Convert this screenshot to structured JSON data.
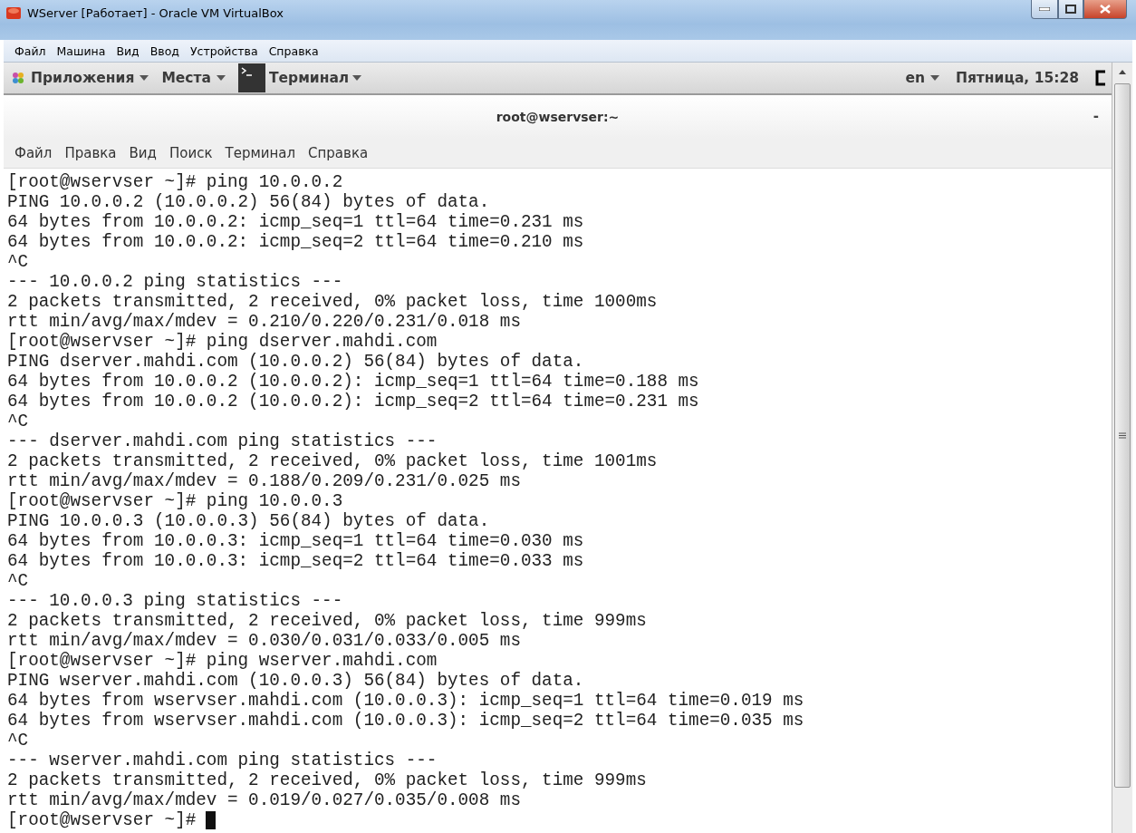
{
  "window": {
    "title": "WServer [Работает] - Oracle VM VirtualBox"
  },
  "vbox_menu": [
    "Файл",
    "Машина",
    "Вид",
    "Ввод",
    "Устройства",
    "Справка"
  ],
  "panel": {
    "applications": "Приложения",
    "places": "Места",
    "terminal": "Терминал",
    "language": "en",
    "clock": "Пятница, 15:28"
  },
  "terminal": {
    "title": "root@wservser:~",
    "minimize": "-",
    "menu": [
      "Файл",
      "Правка",
      "Вид",
      "Поиск",
      "Терминал",
      "Справка"
    ],
    "lines": [
      "[root@wservser ~]# ping 10.0.0.2",
      "PING 10.0.0.2 (10.0.0.2) 56(84) bytes of data.",
      "64 bytes from 10.0.0.2: icmp_seq=1 ttl=64 time=0.231 ms",
      "64 bytes from 10.0.0.2: icmp_seq=2 ttl=64 time=0.210 ms",
      "^C",
      "--- 10.0.0.2 ping statistics ---",
      "2 packets transmitted, 2 received, 0% packet loss, time 1000ms",
      "rtt min/avg/max/mdev = 0.210/0.220/0.231/0.018 ms",
      "[root@wservser ~]# ping dserver.mahdi.com",
      "PING dserver.mahdi.com (10.0.0.2) 56(84) bytes of data.",
      "64 bytes from 10.0.0.2 (10.0.0.2): icmp_seq=1 ttl=64 time=0.188 ms",
      "64 bytes from 10.0.0.2 (10.0.0.2): icmp_seq=2 ttl=64 time=0.231 ms",
      "^C",
      "--- dserver.mahdi.com ping statistics ---",
      "2 packets transmitted, 2 received, 0% packet loss, time 1001ms",
      "rtt min/avg/max/mdev = 0.188/0.209/0.231/0.025 ms",
      "[root@wservser ~]# ping 10.0.0.3",
      "PING 10.0.0.3 (10.0.0.3) 56(84) bytes of data.",
      "64 bytes from 10.0.0.3: icmp_seq=1 ttl=64 time=0.030 ms",
      "64 bytes from 10.0.0.3: icmp_seq=2 ttl=64 time=0.033 ms",
      "^C",
      "--- 10.0.0.3 ping statistics ---",
      "2 packets transmitted, 2 received, 0% packet loss, time 999ms",
      "rtt min/avg/max/mdev = 0.030/0.031/0.033/0.005 ms",
      "[root@wservser ~]# ping wserver.mahdi.com",
      "PING wserver.mahdi.com (10.0.0.3) 56(84) bytes of data.",
      "64 bytes from wservser.mahdi.com (10.0.0.3): icmp_seq=1 ttl=64 time=0.019 ms",
      "64 bytes from wservser.mahdi.com (10.0.0.3): icmp_seq=2 ttl=64 time=0.035 ms",
      "^C",
      "--- wserver.mahdi.com ping statistics ---",
      "2 packets transmitted, 2 received, 0% packet loss, time 999ms",
      "rtt min/avg/max/mdev = 0.019/0.027/0.035/0.008 ms"
    ],
    "prompt": "[root@wservser ~]#"
  }
}
